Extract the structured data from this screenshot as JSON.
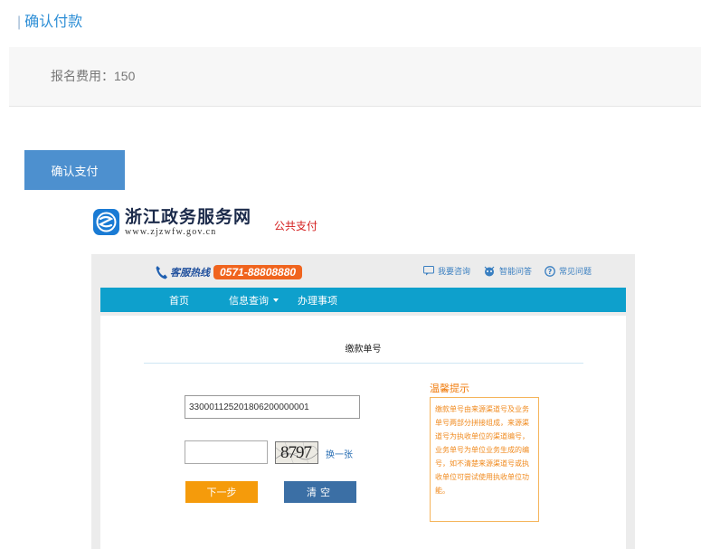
{
  "header": {
    "title": "确认付款"
  },
  "fee": {
    "label": "报名费用：150"
  },
  "confirm_button": {
    "label": "确认支付"
  },
  "logo": {
    "name": "浙江政务服务网",
    "url": "www.zjzwfw.gov.cn"
  },
  "public_pay": {
    "label": "公共支付"
  },
  "gov_portal": {
    "hotline": {
      "label": "客服热线",
      "number": "0571-88808880"
    },
    "help_links": [
      {
        "label": "我要咨询",
        "icon": "chat-icon"
      },
      {
        "label": "智能问答",
        "icon": "robot-icon"
      },
      {
        "label": "常见问题",
        "icon": "question-icon"
      }
    ],
    "nav": {
      "home": "首页",
      "query": "信息查询",
      "handle": "办理事项"
    },
    "form": {
      "title": "缴款单号",
      "bill_number": "330001125201806200000001",
      "captcha_value": "",
      "captcha_text": "8797",
      "refresh_label": "换一张",
      "next_label": "下一步",
      "clear_label": "清空"
    },
    "tip": {
      "title": "温馨提示",
      "text": "缴款单号由来源渠道号及业务单号两部分拼接组成，来源渠道号为执收单位的渠道编号，业务单号为单位业务生成的编号，如不清楚来源渠道号或执收单位可尝试使用执收单位功能。"
    },
    "colors": {
      "nav": "#0ea0cc",
      "next": "#f59b0b",
      "clear": "#3b6fa5",
      "hotline": "#f0641e"
    }
  }
}
